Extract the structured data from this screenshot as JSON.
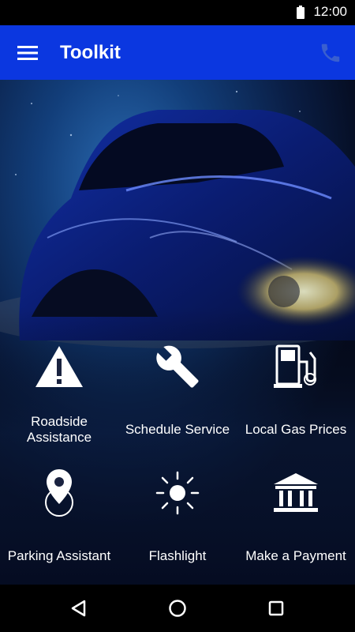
{
  "status_bar": {
    "time": "12:00"
  },
  "app_bar": {
    "title": "Toolkit"
  },
  "tiles": [
    {
      "label": "Roadside Assistance",
      "icon": "warning-icon"
    },
    {
      "label": "Schedule Service",
      "icon": "wrench-icon"
    },
    {
      "label": "Local Gas Prices",
      "icon": "gas-pump-icon"
    },
    {
      "label": "Parking Assistant",
      "icon": "map-pin-icon"
    },
    {
      "label": "Flashlight",
      "icon": "sun-icon"
    },
    {
      "label": "Make a Payment",
      "icon": "bank-icon"
    }
  ],
  "colors": {
    "app_bar": "#0b37e0",
    "status_bar": "#000000",
    "nav_bar": "#000000",
    "text": "#ffffff"
  }
}
